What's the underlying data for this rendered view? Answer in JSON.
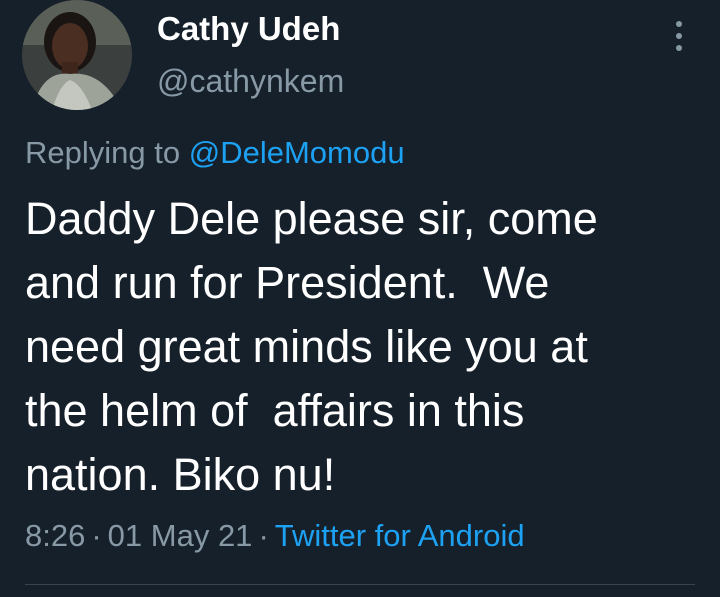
{
  "colors": {
    "background": "#15202b",
    "primary_text": "#ffffff",
    "secondary_text": "#8899a6",
    "link": "#1da1f2",
    "divider": "#38444d"
  },
  "author": {
    "display_name": "Cathy Udeh",
    "handle": "@cathynkem",
    "avatar_icon": "profile-photo"
  },
  "more_icon": "more-vertical-icon",
  "reply": {
    "prefix": "Replying to",
    "mention": "@DeleMomodu"
  },
  "tweet": {
    "text": "Daddy Dele please sir, come\nand run for President.  We\nneed great minds like you at\nthe helm of  affairs in this\nnation. Biko nu!"
  },
  "meta": {
    "time": "8:26",
    "separator": "·",
    "date": "01 May 21",
    "source": "Twitter for Android"
  }
}
